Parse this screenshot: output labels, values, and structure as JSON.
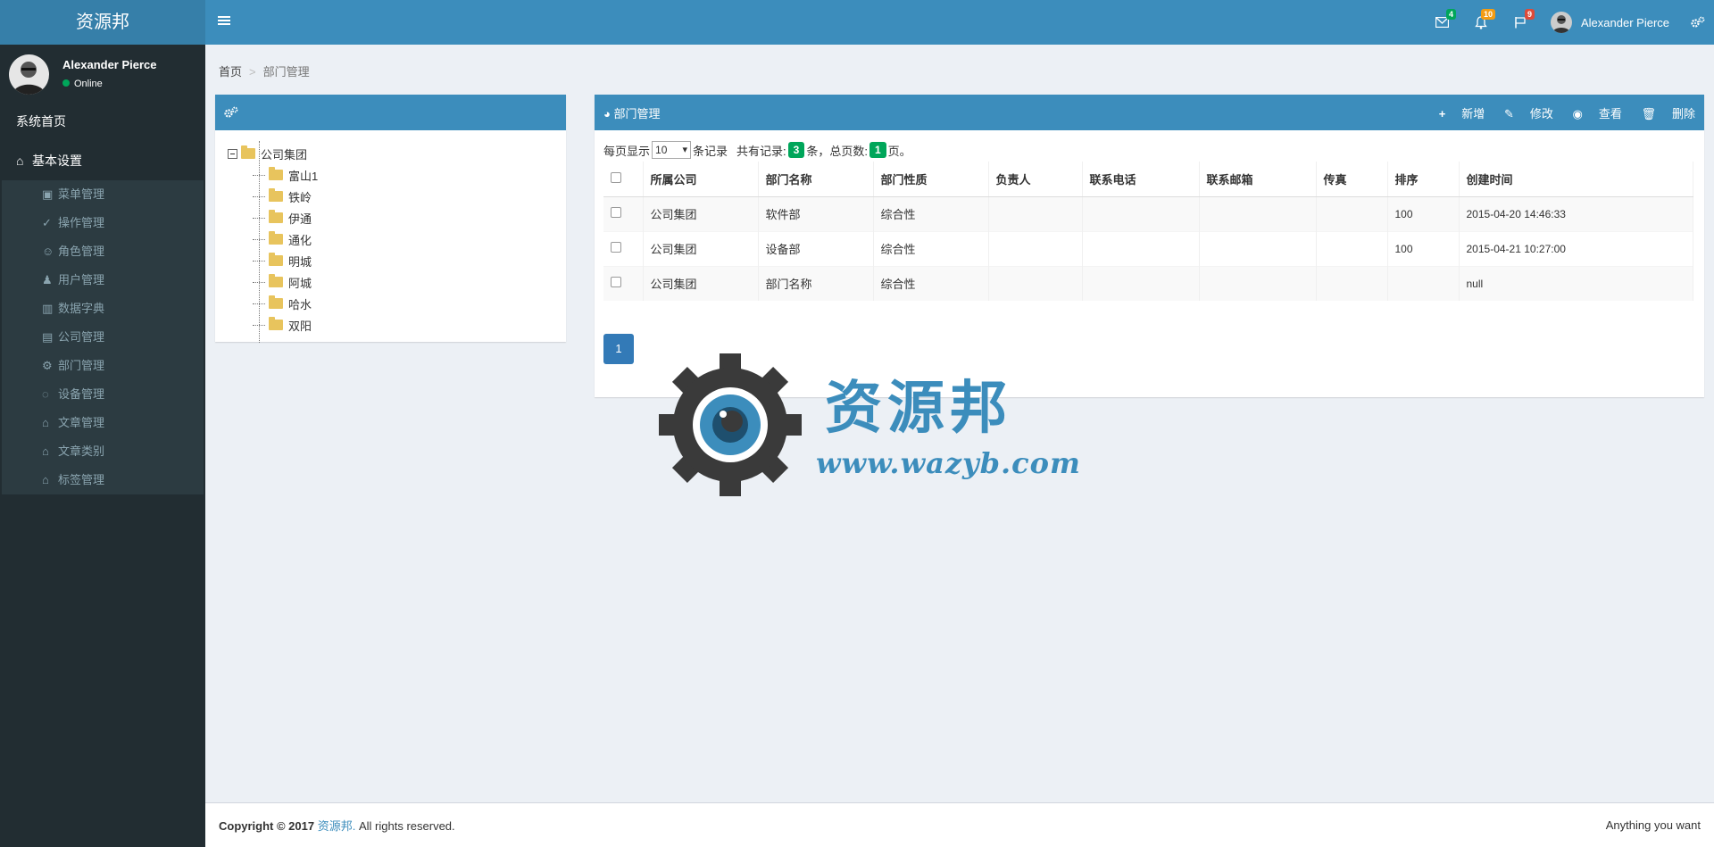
{
  "app": {
    "logo": "资源邦"
  },
  "header": {
    "messages_count": "4",
    "notifications_count": "10",
    "tasks_count": "9",
    "user_name": "Alexander Pierce",
    "badge_colors": {
      "messages": "#00a65a",
      "notifications": "#f39c12",
      "tasks": "#dd4b39"
    }
  },
  "sidebar": {
    "user_name": "Alexander Pierce",
    "status": "Online",
    "home": "系统首页",
    "basic": "基本设置",
    "items": [
      {
        "label": "菜单管理",
        "icon": "menu-icon"
      },
      {
        "label": "操作管理",
        "icon": "check-circle-icon"
      },
      {
        "label": "角色管理",
        "icon": "user-icon"
      },
      {
        "label": "用户管理",
        "icon": "user-plus-icon"
      },
      {
        "label": "数据字典",
        "icon": "bar-chart-icon"
      },
      {
        "label": "公司管理",
        "icon": "briefcase-icon"
      },
      {
        "label": "部门管理",
        "icon": "gear-icon"
      },
      {
        "label": "设备管理",
        "icon": "lightbulb-icon"
      },
      {
        "label": "文章管理",
        "icon": "home-icon"
      },
      {
        "label": "文章类别",
        "icon": "home-icon"
      },
      {
        "label": "标签管理",
        "icon": "home-icon"
      }
    ]
  },
  "breadcrumb": {
    "home": "首页",
    "sep": ">",
    "current": "部门管理"
  },
  "tree": {
    "root": "公司集团",
    "children": [
      "富山1",
      "铁岭",
      "伊通",
      "通化",
      "明城",
      "阿城",
      "哈水",
      "双阳"
    ]
  },
  "dept": {
    "title": "部门管理",
    "actions": {
      "add": "新增",
      "edit": "修改",
      "view": "查看",
      "delete": "删除"
    },
    "per_page_label": "每页显示",
    "per_page_value": "10",
    "records_label": "条记录",
    "total_label": "共有记录:",
    "total_count": "3",
    "total_unit": "条，总页数:",
    "pages_count": "1",
    "pages_unit": "页。",
    "columns": [
      "所属公司",
      "部门名称",
      "部门性质",
      "负责人",
      "联系电话",
      "联系邮箱",
      "传真",
      "排序",
      "创建时间"
    ],
    "rows": [
      [
        "公司集团",
        "软件部",
        "综合性",
        "",
        "",
        "",
        "",
        "100",
        "2015-04-20 14:46:33"
      ],
      [
        "公司集团",
        "设备部",
        "综合性",
        "",
        "",
        "",
        "",
        "100",
        "2015-04-21 10:27:00"
      ],
      [
        "公司集团",
        "部门名称",
        "综合性",
        "",
        "",
        "",
        "",
        "",
        "null"
      ]
    ],
    "page": "1"
  },
  "watermark": {
    "text": "资源邦",
    "url": "www.wazyb.com"
  },
  "footer": {
    "copyright": "Copyright © 2017",
    "brand": "资源邦.",
    "rights": "All rights reserved.",
    "right_text": "Anything you want"
  }
}
